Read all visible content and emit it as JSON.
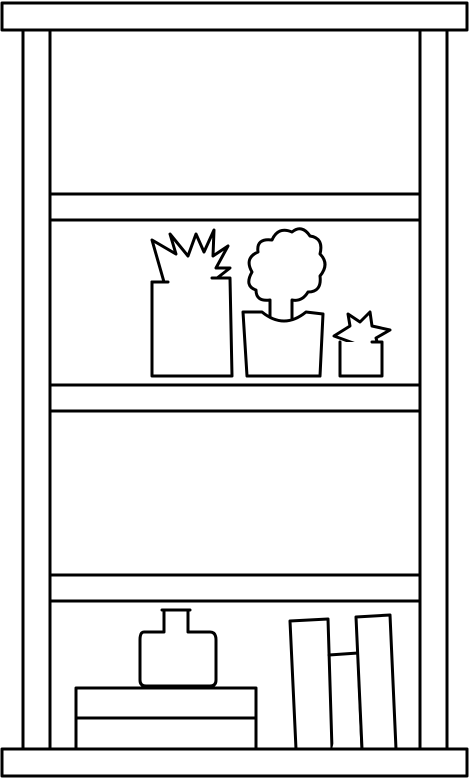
{
  "scene": {
    "subject": "bookshelf-line-drawing",
    "stroke_color": "#000000",
    "fill_color": "#ffffff"
  },
  "icons": {
    "plants": [
      "spiky-plant-icon",
      "round-bush-plant-icon",
      "star-succulent-icon"
    ],
    "vase": "bottle-vase-icon",
    "books": [
      "lying-book-icon",
      "standing-book-icon"
    ]
  }
}
